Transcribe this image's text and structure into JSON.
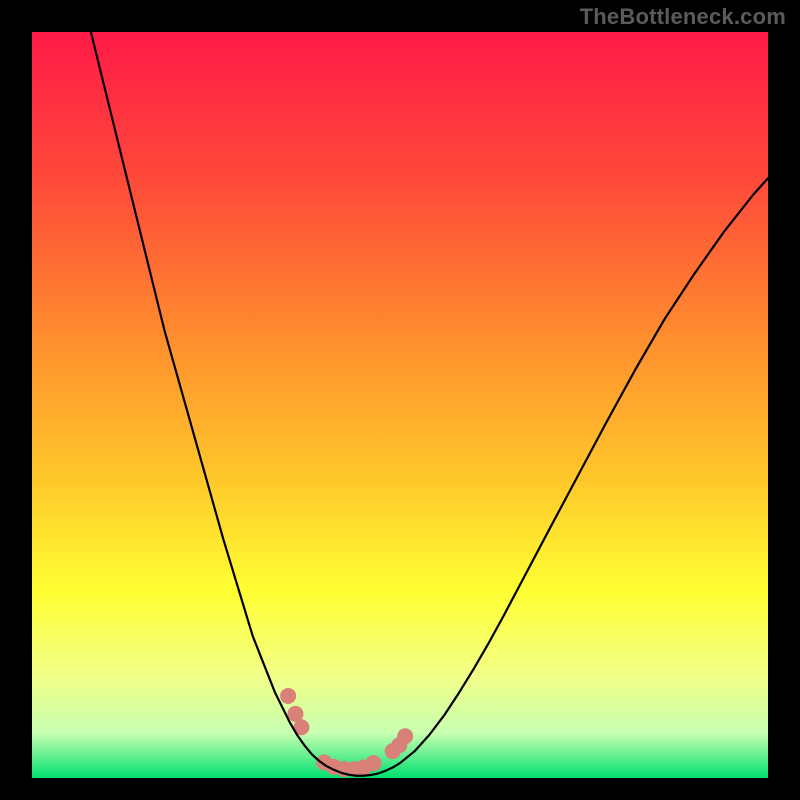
{
  "watermark": {
    "text": "TheBottleneck.com"
  },
  "chart_data": {
    "type": "line",
    "title": "",
    "xlabel": "",
    "ylabel": "",
    "xlim": [
      0,
      100
    ],
    "ylim": [
      0,
      100
    ],
    "grid": false,
    "legend": false,
    "background_gradient": {
      "direction": "vertical",
      "stops": [
        {
          "pos": 0.0,
          "color": "#ff1a47"
        },
        {
          "pos": 0.2,
          "color": "#ff4a3a"
        },
        {
          "pos": 0.4,
          "color": "#ff8a2e"
        },
        {
          "pos": 0.6,
          "color": "#ffc82a"
        },
        {
          "pos": 0.75,
          "color": "#ffff33"
        },
        {
          "pos": 0.86,
          "color": "#f2ff85"
        },
        {
          "pos": 0.94,
          "color": "#c8ffb0"
        },
        {
          "pos": 1.0,
          "color": "#00e070"
        }
      ]
    },
    "series": [
      {
        "name": "bottleneck-curve",
        "color": "#000000",
        "width": 2.2,
        "points_xy": [
          [
            8,
            100
          ],
          [
            10,
            92
          ],
          [
            12,
            84
          ],
          [
            14,
            76
          ],
          [
            16,
            68
          ],
          [
            18,
            60
          ],
          [
            20,
            53
          ],
          [
            22,
            46
          ],
          [
            24,
            39
          ],
          [
            26,
            32
          ],
          [
            28,
            25.5
          ],
          [
            30,
            19
          ],
          [
            31,
            16.5
          ],
          [
            32,
            14
          ],
          [
            33,
            11.5
          ],
          [
            34,
            9.5
          ],
          [
            35,
            7.5
          ],
          [
            36,
            5.8
          ],
          [
            37,
            4.4
          ],
          [
            38,
            3.2
          ],
          [
            39,
            2.3
          ],
          [
            40,
            1.6
          ],
          [
            41,
            1.1
          ],
          [
            42,
            0.7
          ],
          [
            43,
            0.45
          ],
          [
            44,
            0.3
          ],
          [
            45,
            0.3
          ],
          [
            46,
            0.4
          ],
          [
            47,
            0.6
          ],
          [
            48,
            0.95
          ],
          [
            49,
            1.4
          ],
          [
            50,
            2.0
          ],
          [
            52,
            3.6
          ],
          [
            54,
            5.8
          ],
          [
            56,
            8.4
          ],
          [
            58,
            11.4
          ],
          [
            60,
            14.6
          ],
          [
            62,
            18.0
          ],
          [
            64,
            21.6
          ],
          [
            67,
            27.2
          ],
          [
            70,
            32.8
          ],
          [
            74,
            40.2
          ],
          [
            78,
            47.6
          ],
          [
            82,
            54.8
          ],
          [
            86,
            61.6
          ],
          [
            90,
            67.6
          ],
          [
            94,
            73.2
          ],
          [
            98,
            78.2
          ],
          [
            100,
            80.4
          ]
        ]
      },
      {
        "name": "marker-dots",
        "color": "#d98079",
        "radius": 8,
        "points_xy": [
          [
            34.8,
            11.0
          ],
          [
            35.8,
            8.6
          ],
          [
            36.6,
            6.8
          ],
          [
            39.7,
            2.1
          ],
          [
            41.0,
            1.5
          ],
          [
            42.4,
            1.2
          ],
          [
            43.8,
            1.2
          ],
          [
            45.1,
            1.4
          ],
          [
            46.4,
            2.0
          ],
          [
            49.0,
            3.6
          ],
          [
            49.9,
            4.4
          ],
          [
            50.7,
            5.6
          ]
        ]
      }
    ]
  }
}
